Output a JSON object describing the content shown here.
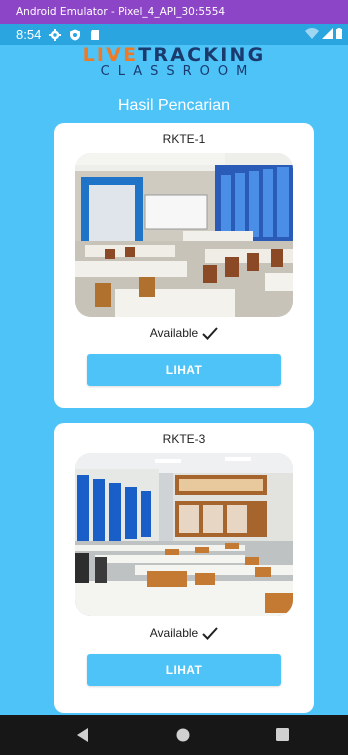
{
  "emulator": {
    "title": "Android Emulator - Pixel_4_API_30:5554"
  },
  "status_bar": {
    "time": "8:54",
    "icons": [
      "gear-icon",
      "shield-icon",
      "sd-card-icon",
      "wifi-icon",
      "signal-icon",
      "battery-icon"
    ]
  },
  "app": {
    "logo": {
      "part_orange": "LIVE",
      "part_blue": "TRACKING",
      "subtitle": "CLASSROOM"
    },
    "heading": "Hasil Pencarian",
    "colors": {
      "background": "#4dc3f8",
      "button": "#4dc3f8",
      "logo_orange": "#f07a24",
      "logo_blue": "#1a3a6e"
    },
    "results": [
      {
        "room": "RKTE-1",
        "status": "Available",
        "button_label": "LIHAT"
      },
      {
        "room": "RKTE-3",
        "status": "Available",
        "button_label": "LIHAT"
      }
    ]
  },
  "nav_bar": {
    "icons": [
      "back-icon",
      "home-icon",
      "recents-icon"
    ]
  }
}
